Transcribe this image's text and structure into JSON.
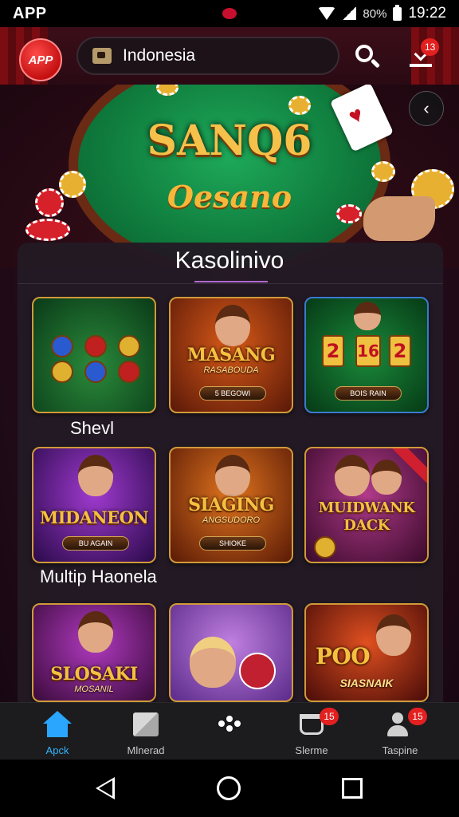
{
  "status_bar": {
    "app_label": "APP",
    "battery": "80%",
    "time": "19:22"
  },
  "header": {
    "logo_text": "APP",
    "search_value": "Indonesia",
    "download_badge": "13"
  },
  "hero": {
    "title_line1": "SANQ6",
    "title_line2": "Oesano"
  },
  "section": {
    "title": "Kasolinivo"
  },
  "rows": [
    {
      "label": "Shevl",
      "tiles": [
        {
          "title": "",
          "sub": "",
          "button": "",
          "theme": "#1a6a2a"
        },
        {
          "title": "MASANG",
          "sub": "RASABOUDA",
          "button": "5 BEGOWI",
          "theme": "#8a2a10"
        },
        {
          "title": "",
          "sub": "",
          "button": "BOIS RAIN",
          "theme": "#0e5a26",
          "reels": [
            "2",
            "16",
            "2"
          ]
        }
      ]
    },
    {
      "label": "Multip Haonela",
      "tiles": [
        {
          "title": "MIDANEON",
          "sub": "",
          "button": "BU AGAIN",
          "theme": "#5a1a7a"
        },
        {
          "title": "SIAGING",
          "sub": "ANGSUDORO",
          "button": "SHIOKE",
          "theme": "#8a3a12"
        },
        {
          "title": "MUIDWANK DACK",
          "sub": "",
          "button": "",
          "theme": "#6a1a4a"
        }
      ]
    },
    {
      "label": "",
      "tiles": [
        {
          "title": "SLOSAKI",
          "sub": "MOSANIL",
          "button": "",
          "theme": "#6a1a6a"
        },
        {
          "title": "",
          "sub": "",
          "button": "",
          "theme": "#7a3aa0"
        },
        {
          "title": "POO",
          "sub": "SIASNAIK",
          "button": "",
          "theme": "#7a1a10"
        }
      ]
    }
  ],
  "bottom_nav": [
    {
      "label": "Apck",
      "badge": ""
    },
    {
      "label": "Mlnerad",
      "badge": ""
    },
    {
      "label": "",
      "badge": ""
    },
    {
      "label": "Slerme",
      "badge": "15"
    },
    {
      "label": "Taspine",
      "badge": "15"
    }
  ],
  "colors": {
    "accent": "#2aa6ff",
    "badge": "#e32020",
    "gold": "#f5c040"
  }
}
